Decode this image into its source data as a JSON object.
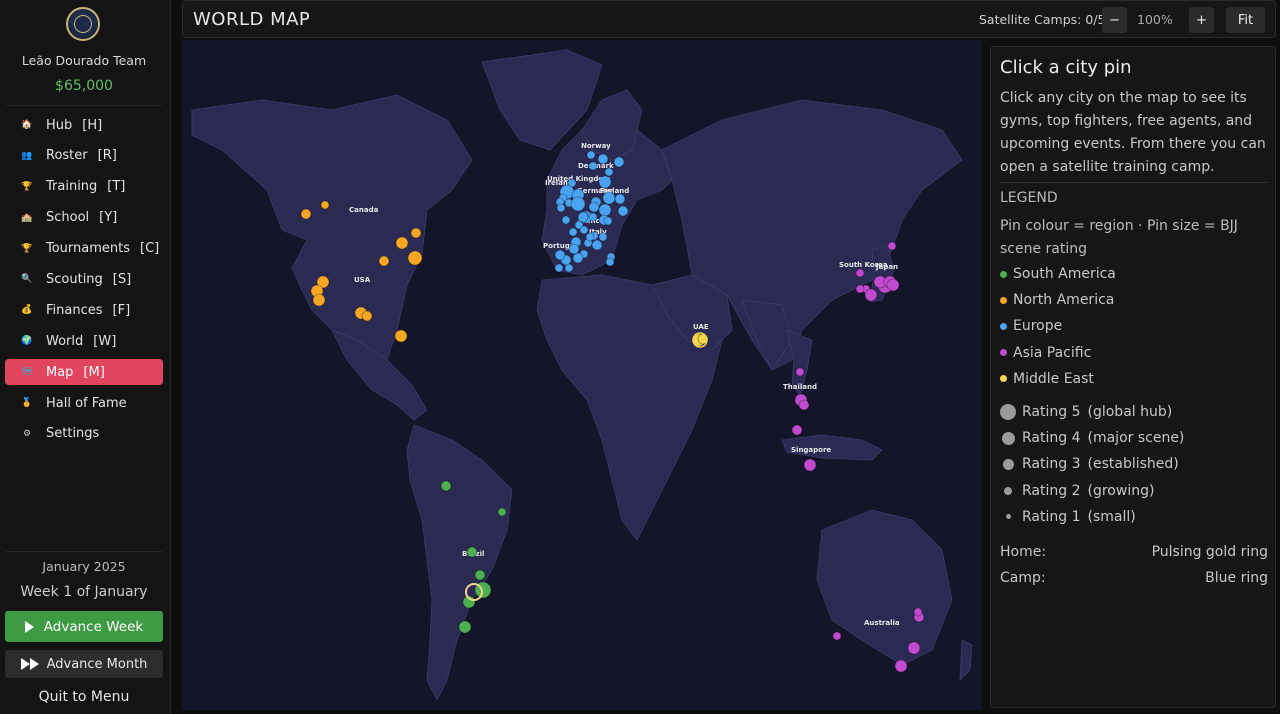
{
  "sidebar": {
    "team_name": "Leão Dourado Team",
    "money": "$65,000",
    "nav": [
      {
        "label": "Hub",
        "key": "[H]",
        "icon": "house-icon",
        "glyph": "🏠",
        "color": "#e07a3b",
        "active": false
      },
      {
        "label": "Roster",
        "key": "[R]",
        "icon": "people-icon",
        "glyph": "👥",
        "color": "#7a5fa6",
        "active": false
      },
      {
        "label": "Training",
        "key": "[T]",
        "icon": "trophy-icon",
        "glyph": "🏆",
        "color": "#c9902a",
        "active": false
      },
      {
        "label": "School",
        "key": "[Y]",
        "icon": "school-icon",
        "glyph": "🏫",
        "color": "#7c5cc4",
        "active": false
      },
      {
        "label": "Tournaments",
        "key": "[C]",
        "icon": "trophy-icon",
        "glyph": "🏆",
        "color": "#d4a23a",
        "active": false
      },
      {
        "label": "Scouting",
        "key": "[S]",
        "icon": "magnifier-icon",
        "glyph": "🔍",
        "color": "#3a8fd4",
        "active": false
      },
      {
        "label": "Finances",
        "key": "[F]",
        "icon": "money-bag-icon",
        "glyph": "💰",
        "color": "#d6a23a",
        "active": false
      },
      {
        "label": "World",
        "key": "[W]",
        "icon": "globe-icon",
        "glyph": "🌍",
        "color": "#2f8f6f",
        "active": false
      },
      {
        "label": "Map",
        "key": "[M]",
        "icon": "map-icon",
        "glyph": "🗺",
        "color": "#3aa7c9",
        "active": true
      },
      {
        "label": "Hall of Fame",
        "key": "",
        "icon": "medal-icon",
        "glyph": "🏅",
        "color": "#e0a030",
        "active": false
      },
      {
        "label": "Settings",
        "key": "",
        "icon": "gear-icon",
        "glyph": "⚙",
        "color": "#cfcfcf",
        "active": false
      }
    ],
    "date": "January 2025",
    "week": "Week 1 of January",
    "advance_week": "Advance Week",
    "advance_month": "Advance Month",
    "quit": "Quit to Menu"
  },
  "header": {
    "title": "WORLD MAP",
    "satellite_camps": "Satellite Camps: 0/5",
    "zoom_out": "−",
    "zoom": "100%",
    "zoom_in": "+",
    "fit": "Fit"
  },
  "map": {
    "labels": [
      "Norway",
      "Denmark",
      "United Kingdom",
      "Ireland",
      "Germany",
      "Finland",
      "France",
      "Italy",
      "Portugal",
      "Canada",
      "USA",
      "UAE",
      "South Korea",
      "Japan",
      "Thailand",
      "Singapore",
      "Australia",
      "Brazil"
    ]
  },
  "panel": {
    "title": "Click a city pin",
    "description": "Click any city on the map to see its gyms, top fighters, free agents, and upcoming events. From there you can open a satellite training camp.",
    "legend_title": "LEGEND",
    "colour_note": "Pin colour = region · Pin size = BJJ scene rating",
    "regions": [
      {
        "name": "South America",
        "color": "#4caf50"
      },
      {
        "name": "North America",
        "color": "#f5a623"
      },
      {
        "name": "Europe",
        "color": "#4aa3f0"
      },
      {
        "name": "Asia Pacific",
        "color": "#c04ad0"
      },
      {
        "name": "Middle East",
        "color": "#f2d64b"
      }
    ],
    "ratings": [
      {
        "label": "Rating 5",
        "desc": "(global hub)"
      },
      {
        "label": "Rating 4",
        "desc": "(major scene)"
      },
      {
        "label": "Rating 3",
        "desc": "(established)"
      },
      {
        "label": "Rating 2",
        "desc": "(growing)"
      },
      {
        "label": "Rating 1",
        "desc": "(small)"
      }
    ],
    "home_label": "Home:",
    "home_value": "Pulsing gold ring",
    "camp_label": "Camp:",
    "camp_value": "Blue ring"
  }
}
